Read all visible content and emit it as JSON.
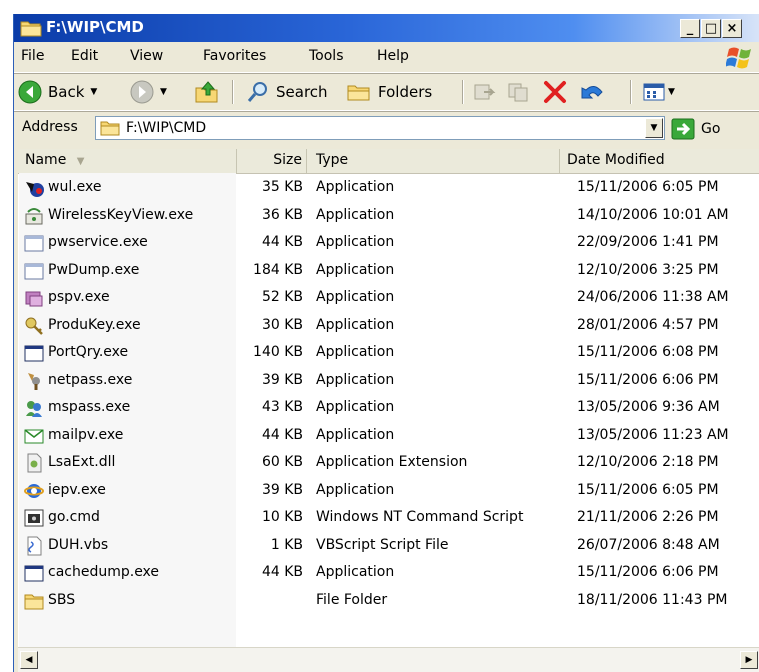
{
  "window": {
    "title": "F:\\WIP\\CMD"
  },
  "caption_buttons": {
    "minimize": "_",
    "maximize": "□",
    "close": "×"
  },
  "menu": [
    "File",
    "Edit",
    "View",
    "Favorites",
    "Tools",
    "Help"
  ],
  "toolbar": {
    "back": "Back",
    "search": "Search",
    "folders": "Folders"
  },
  "address": {
    "label": "Address",
    "value": "F:\\WIP\\CMD",
    "go": "Go"
  },
  "columns": {
    "name": "Name",
    "size": "Size",
    "type": "Type",
    "modified": "Date Modified"
  },
  "files": [
    {
      "name": "wul.exe",
      "size": "35 KB",
      "type": "Application",
      "modified": "15/11/2006 6:05 PM",
      "icon": "wul-app-icon"
    },
    {
      "name": "WirelessKeyView.exe",
      "size": "36 KB",
      "type": "Application",
      "modified": "14/10/2006 10:01 AM",
      "icon": "wireless-key-icon"
    },
    {
      "name": "pwservice.exe",
      "size": "44 KB",
      "type": "Application",
      "modified": "22/09/2006 1:41 PM",
      "icon": "generic-window-icon"
    },
    {
      "name": "PwDump.exe",
      "size": "184 KB",
      "type": "Application",
      "modified": "12/10/2006 3:25 PM",
      "icon": "generic-window-icon"
    },
    {
      "name": "pspv.exe",
      "size": "52 KB",
      "type": "Application",
      "modified": "24/06/2006 11:38 AM",
      "icon": "pspv-icon"
    },
    {
      "name": "ProduKey.exe",
      "size": "30 KB",
      "type": "Application",
      "modified": "28/01/2006 4:57 PM",
      "icon": "key-icon"
    },
    {
      "name": "PortQry.exe",
      "size": "140 KB",
      "type": "Application",
      "modified": "15/11/2006 6:08 PM",
      "icon": "console-window-icon"
    },
    {
      "name": "netpass.exe",
      "size": "39 KB",
      "type": "Application",
      "modified": "15/11/2006 6:06 PM",
      "icon": "netpass-keys-icon"
    },
    {
      "name": "mspass.exe",
      "size": "43 KB",
      "type": "Application",
      "modified": "13/05/2006 9:36 AM",
      "icon": "msn-users-icon"
    },
    {
      "name": "mailpv.exe",
      "size": "44 KB",
      "type": "Application",
      "modified": "13/05/2006 11:23 AM",
      "icon": "mail-envelope-icon"
    },
    {
      "name": "LsaExt.dll",
      "size": "60 KB",
      "type": "Application Extension",
      "modified": "12/10/2006 2:18 PM",
      "icon": "dll-file-icon"
    },
    {
      "name": "iepv.exe",
      "size": "39 KB",
      "type": "Application",
      "modified": "15/11/2006 6:05 PM",
      "icon": "ie-globe-icon"
    },
    {
      "name": "go.cmd",
      "size": "10 KB",
      "type": "Windows NT Command Script",
      "modified": "21/11/2006 2:26 PM",
      "icon": "cmd-script-icon"
    },
    {
      "name": "DUH.vbs",
      "size": "1 KB",
      "type": "VBScript Script File",
      "modified": "26/07/2006 8:48 AM",
      "icon": "vbs-script-icon"
    },
    {
      "name": "cachedump.exe",
      "size": "44 KB",
      "type": "Application",
      "modified": "15/11/2006 6:06 PM",
      "icon": "console-window-icon"
    },
    {
      "name": "SBS",
      "size": "",
      "type": "File Folder",
      "modified": "18/11/2006 11:43 PM",
      "icon": "folder-icon"
    }
  ],
  "colors": {
    "title_start": "#0a3ba8",
    "title_end": "#d8e4f8",
    "chrome": "#ece9d8",
    "selection_col": "#f7f7f7"
  }
}
